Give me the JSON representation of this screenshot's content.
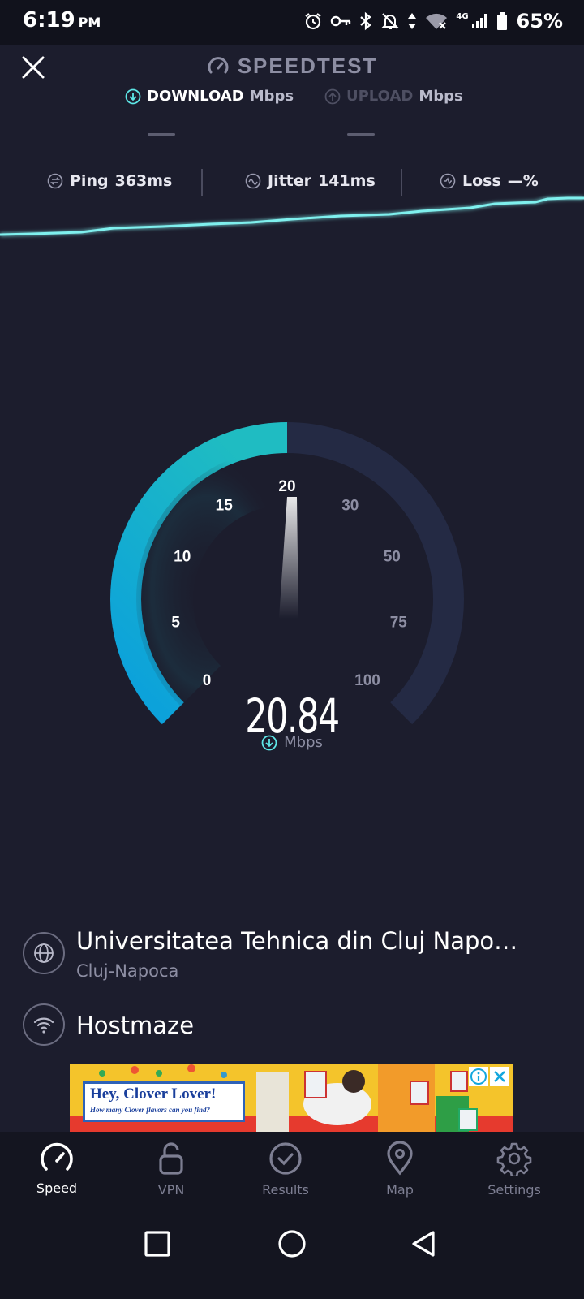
{
  "status_bar": {
    "time": "6:19",
    "ampm": "PM",
    "network": "4G",
    "battery": "65%",
    "icons": [
      "alarm-icon",
      "vpn-key-icon",
      "bluetooth-icon",
      "notifications-off-icon",
      "data-arrows-icon",
      "wifi-off-icon",
      "signal-icon",
      "battery-icon"
    ]
  },
  "header": {
    "title": "SPEEDTEST",
    "download_label": "DOWNLOAD",
    "upload_label": "UPLOAD",
    "units": "Mbps",
    "download_value": "—",
    "upload_value": "—"
  },
  "stats": {
    "ping_label": "Ping",
    "ping_value": "363ms",
    "jitter_label": "Jitter",
    "jitter_value": "141ms",
    "loss_label": "Loss",
    "loss_value": "—%"
  },
  "gauge": {
    "scale_labels": [
      "0",
      "5",
      "10",
      "15",
      "20",
      "30",
      "50",
      "75",
      "100"
    ],
    "current_value": "20.84",
    "unit": "Mbps",
    "fill_fraction": 0.5,
    "fill_color": "#1eb8c6",
    "track_color": "#242a44"
  },
  "server": {
    "name": "Universitatea Tehnica din Cluj Napo…",
    "location": "Cluj-Napoca"
  },
  "isp": {
    "name": "Hostmaze"
  },
  "ad": {
    "title": "Hey, Clover Lover!",
    "subtitle": "How many Clover flavors can you find?"
  },
  "nav": {
    "items": [
      {
        "label": "Speed",
        "icon": "speedometer-icon",
        "active": true
      },
      {
        "label": "VPN",
        "icon": "lock-icon",
        "active": false
      },
      {
        "label": "Results",
        "icon": "check-circle-icon",
        "active": false
      },
      {
        "label": "Map",
        "icon": "map-pin-icon",
        "active": false
      },
      {
        "label": "Settings",
        "icon": "gear-icon",
        "active": false
      }
    ]
  },
  "colors": {
    "background": "#1c1d2d",
    "accent": "#5ee8e8",
    "text_muted": "#8d8ea3"
  }
}
